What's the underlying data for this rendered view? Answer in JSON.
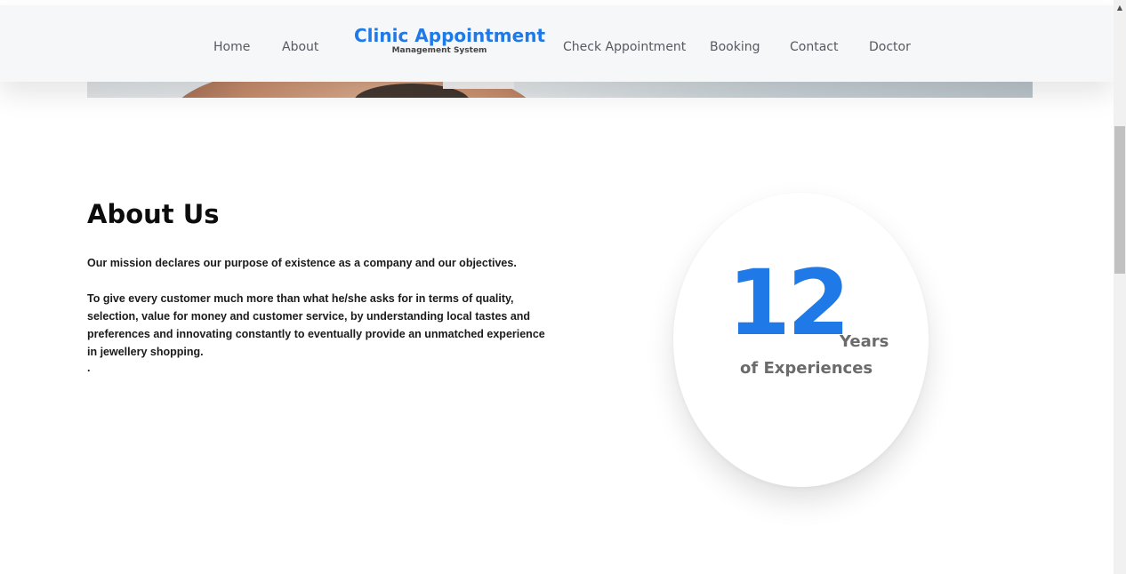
{
  "navbar": {
    "items_left": [
      {
        "label": "Home"
      },
      {
        "label": "About"
      }
    ],
    "brand": {
      "title": "Clinic Appointment",
      "subtitle": "Management System"
    },
    "items_right": [
      {
        "label": "Check Appointment"
      },
      {
        "label": "Booking"
      },
      {
        "label": "Contact"
      },
      {
        "label": "Doctor"
      }
    ]
  },
  "about": {
    "heading": "About Us",
    "mission": "Our mission declares our purpose of existence as a company and our objectives.",
    "body": "To give every customer much more than what he/she asks for in terms of quality, selection, value for money and customer service, by understanding local tastes and preferences and innovating constantly to eventually provide an unmatched experience in jewellery shopping.",
    "trailing": "."
  },
  "experience": {
    "number": "12",
    "unit": "Years",
    "label": "of Experiences"
  },
  "colors": {
    "accent": "#1f7ae8",
    "navbar_bg": "#f5f7f9",
    "text_dark": "#1b1b1b",
    "text_muted": "#6b6b6b"
  },
  "icons": {
    "scroll_up": "triangle-up-icon"
  }
}
